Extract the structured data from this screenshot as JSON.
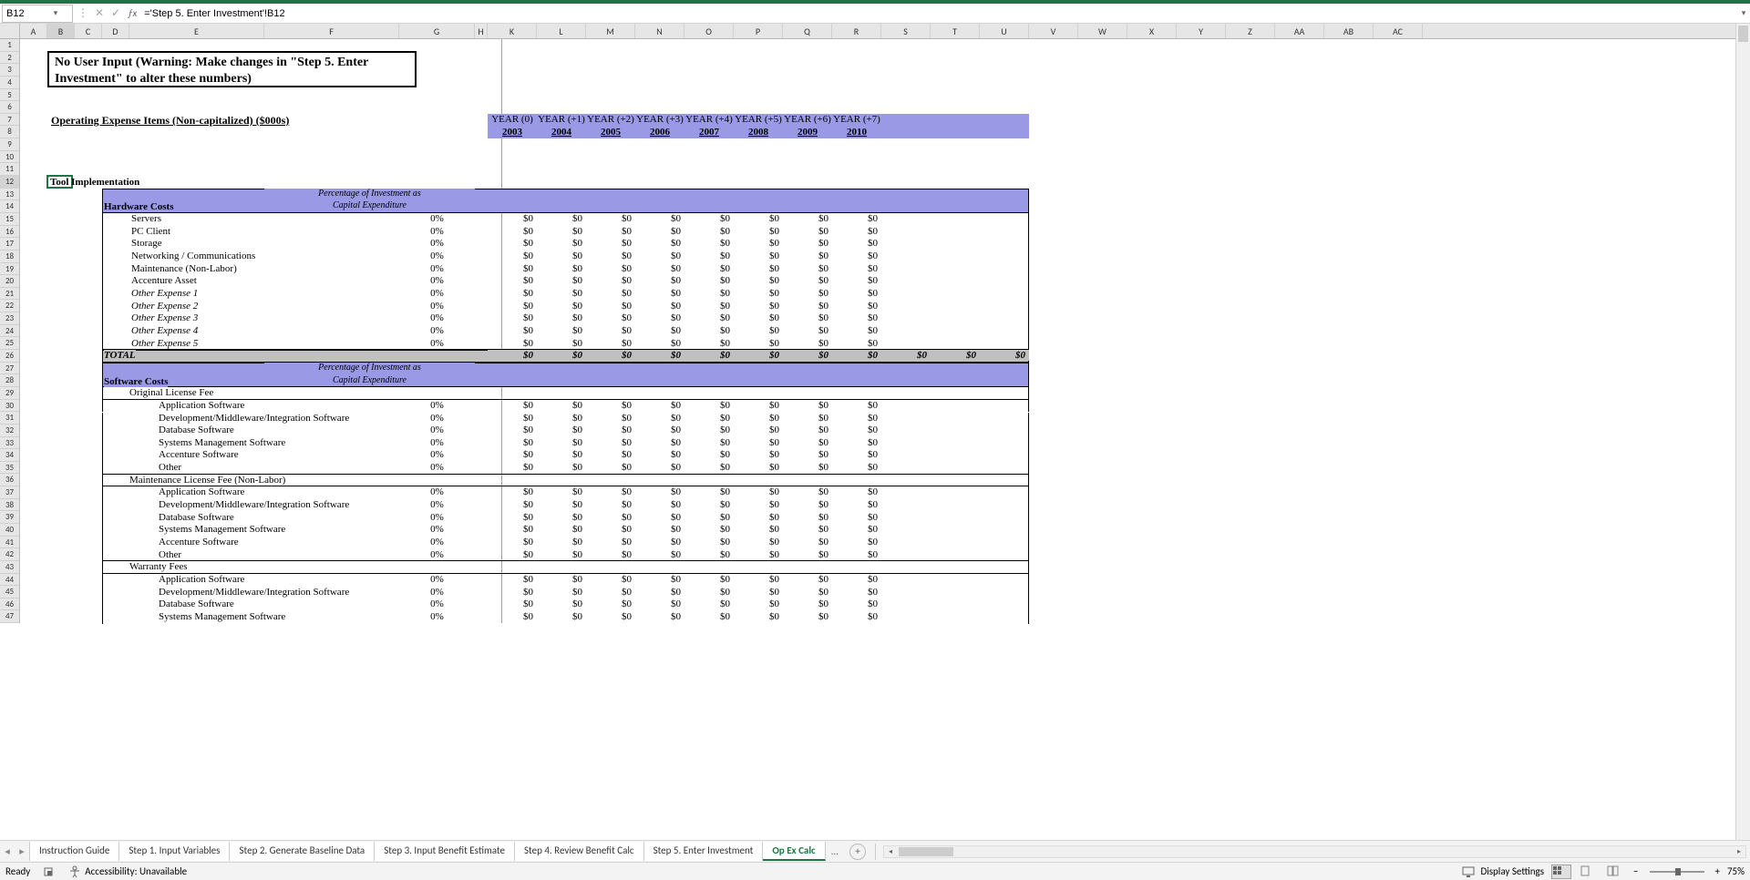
{
  "name_box": "B12",
  "formula": "='Step 5. Enter Investment'!B12",
  "columns": [
    "A",
    "B",
    "C",
    "D",
    "E",
    "F",
    "G",
    "H",
    "K",
    "L",
    "M",
    "N",
    "O",
    "P",
    "Q",
    "R",
    "S",
    "T",
    "U",
    "V",
    "W",
    "X",
    "Y",
    "Z",
    "AA",
    "AB",
    "AC"
  ],
  "col_selected": "B",
  "row_count": 47,
  "row_selected": 12,
  "warning": "No User Input (Warning: Make changes in \"Step 5. Enter Investment\" to alter these numbers)",
  "heading_opex": "Operating Expense Items (Non-capitalized) ($000s)",
  "years_labels": [
    "YEAR (0)",
    "YEAR (+1)",
    "YEAR (+2)",
    "YEAR (+3)",
    "YEAR (+4)",
    "YEAR (+5)",
    "YEAR (+6)",
    "YEAR (+7)"
  ],
  "years": [
    "2003",
    "2004",
    "2005",
    "2006",
    "2007",
    "2008",
    "2009",
    "2010"
  ],
  "active_cell_text": "Tool Implementation",
  "sections": {
    "hardware": {
      "title": "Hardware Costs",
      "sub1": "Percentage of Investment as",
      "sub2": "Capital Expenditure",
      "rows": [
        {
          "label": "Servers",
          "pct": "0%",
          "vals": [
            "$0",
            "$0",
            "$0",
            "$0",
            "$0",
            "$0",
            "$0",
            "$0"
          ]
        },
        {
          "label": "PC Client",
          "pct": "0%",
          "vals": [
            "$0",
            "$0",
            "$0",
            "$0",
            "$0",
            "$0",
            "$0",
            "$0"
          ]
        },
        {
          "label": "Storage",
          "pct": "0%",
          "vals": [
            "$0",
            "$0",
            "$0",
            "$0",
            "$0",
            "$0",
            "$0",
            "$0"
          ]
        },
        {
          "label": "Networking / Communications",
          "pct": "0%",
          "vals": [
            "$0",
            "$0",
            "$0",
            "$0",
            "$0",
            "$0",
            "$0",
            "$0"
          ]
        },
        {
          "label": "Maintenance (Non-Labor)",
          "pct": "0%",
          "vals": [
            "$0",
            "$0",
            "$0",
            "$0",
            "$0",
            "$0",
            "$0",
            "$0"
          ]
        },
        {
          "label": "Accenture Asset",
          "pct": "0%",
          "vals": [
            "$0",
            "$0",
            "$0",
            "$0",
            "$0",
            "$0",
            "$0",
            "$0"
          ]
        },
        {
          "label": "Other Expense 1",
          "italic": true,
          "pct": "0%",
          "vals": [
            "$0",
            "$0",
            "$0",
            "$0",
            "$0",
            "$0",
            "$0",
            "$0"
          ]
        },
        {
          "label": "Other Expense 2",
          "italic": true,
          "pct": "0%",
          "vals": [
            "$0",
            "$0",
            "$0",
            "$0",
            "$0",
            "$0",
            "$0",
            "$0"
          ]
        },
        {
          "label": "Other Expense 3",
          "italic": true,
          "pct": "0%",
          "vals": [
            "$0",
            "$0",
            "$0",
            "$0",
            "$0",
            "$0",
            "$0",
            "$0"
          ]
        },
        {
          "label": "Other Expense 4",
          "italic": true,
          "pct": "0%",
          "vals": [
            "$0",
            "$0",
            "$0",
            "$0",
            "$0",
            "$0",
            "$0",
            "$0"
          ]
        },
        {
          "label": "Other Expense 5",
          "italic": true,
          "pct": "0%",
          "vals": [
            "$0",
            "$0",
            "$0",
            "$0",
            "$0",
            "$0",
            "$0",
            "$0"
          ]
        }
      ],
      "total_label": "TOTAL",
      "total_vals": [
        "$0",
        "$0",
        "$0",
        "$0",
        "$0",
        "$0",
        "$0",
        "$0",
        "$0",
        "$0",
        "$0"
      ]
    },
    "software": {
      "title": "Software Costs",
      "sub1": "Percentage of Investment as",
      "sub2": "Capital Expenditure",
      "groups": [
        {
          "heading": "Original License Fee",
          "rows": [
            {
              "label": "Application Software",
              "pct": "0%",
              "vals": [
                "$0",
                "$0",
                "$0",
                "$0",
                "$0",
                "$0",
                "$0",
                "$0"
              ]
            },
            {
              "label": "Development/Middleware/Integration Software",
              "pct": "0%",
              "vals": [
                "$0",
                "$0",
                "$0",
                "$0",
                "$0",
                "$0",
                "$0",
                "$0"
              ]
            },
            {
              "label": "Database Software",
              "pct": "0%",
              "vals": [
                "$0",
                "$0",
                "$0",
                "$0",
                "$0",
                "$0",
                "$0",
                "$0"
              ]
            },
            {
              "label": "Systems Management Software",
              "pct": "0%",
              "vals": [
                "$0",
                "$0",
                "$0",
                "$0",
                "$0",
                "$0",
                "$0",
                "$0"
              ]
            },
            {
              "label": "Accenture Software",
              "pct": "0%",
              "vals": [
                "$0",
                "$0",
                "$0",
                "$0",
                "$0",
                "$0",
                "$0",
                "$0"
              ]
            },
            {
              "label": "Other",
              "pct": "0%",
              "vals": [
                "$0",
                "$0",
                "$0",
                "$0",
                "$0",
                "$0",
                "$0",
                "$0"
              ]
            }
          ]
        },
        {
          "heading": "Maintenance License Fee (Non-Labor)",
          "rows": [
            {
              "label": "Application Software",
              "pct": "0%",
              "vals": [
                "$0",
                "$0",
                "$0",
                "$0",
                "$0",
                "$0",
                "$0",
                "$0"
              ]
            },
            {
              "label": "Development/Middleware/Integration Software",
              "pct": "0%",
              "vals": [
                "$0",
                "$0",
                "$0",
                "$0",
                "$0",
                "$0",
                "$0",
                "$0"
              ]
            },
            {
              "label": "Database Software",
              "pct": "0%",
              "vals": [
                "$0",
                "$0",
                "$0",
                "$0",
                "$0",
                "$0",
                "$0",
                "$0"
              ]
            },
            {
              "label": "Systems Management Software",
              "pct": "0%",
              "vals": [
                "$0",
                "$0",
                "$0",
                "$0",
                "$0",
                "$0",
                "$0",
                "$0"
              ]
            },
            {
              "label": "Accenture Software",
              "pct": "0%",
              "vals": [
                "$0",
                "$0",
                "$0",
                "$0",
                "$0",
                "$0",
                "$0",
                "$0"
              ]
            },
            {
              "label": "Other",
              "pct": "0%",
              "vals": [
                "$0",
                "$0",
                "$0",
                "$0",
                "$0",
                "$0",
                "$0",
                "$0"
              ]
            }
          ]
        },
        {
          "heading": "Warranty Fees",
          "rows": [
            {
              "label": "Application Software",
              "pct": "0%",
              "vals": [
                "$0",
                "$0",
                "$0",
                "$0",
                "$0",
                "$0",
                "$0",
                "$0"
              ]
            },
            {
              "label": "Development/Middleware/Integration Software",
              "pct": "0%",
              "vals": [
                "$0",
                "$0",
                "$0",
                "$0",
                "$0",
                "$0",
                "$0",
                "$0"
              ]
            },
            {
              "label": "Database Software",
              "pct": "0%",
              "vals": [
                "$0",
                "$0",
                "$0",
                "$0",
                "$0",
                "$0",
                "$0",
                "$0"
              ]
            },
            {
              "label": "Systems Management Software",
              "partial": true,
              "pct": "0%",
              "vals": [
                "$0",
                "$0",
                "$0",
                "$0",
                "$0",
                "$0",
                "$0",
                "$0"
              ]
            }
          ]
        }
      ]
    }
  },
  "tabs": [
    "Instruction Guide",
    "Step 1. Input Variables",
    "Step 2. Generate Baseline Data",
    "Step 3.  Input Benefit Estimate",
    "Step 4. Review Benefit Calc",
    "Step 5. Enter Investment",
    "Op Ex Calc"
  ],
  "tabs_more": "...",
  "active_tab": "Op Ex Calc",
  "status": {
    "ready": "Ready",
    "accessibility": "Accessibility: Unavailable",
    "display": "Display Settings",
    "zoom": "75%"
  }
}
